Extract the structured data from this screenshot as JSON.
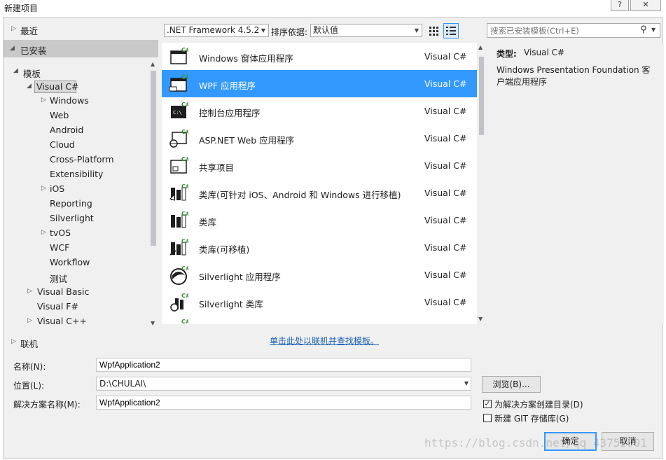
{
  "window": {
    "title": "新建项目",
    "help_glyph": "?",
    "close_glyph": "✕"
  },
  "tree": {
    "recent": "最近",
    "installed": "已安装",
    "templates": "模板",
    "visual_csharp": "Visual C#",
    "csharp_children": [
      "Windows",
      "Web",
      "Android",
      "Cloud",
      "Cross-Platform",
      "Extensibility",
      "iOS",
      "Reporting",
      "Silverlight",
      "tvOS",
      "WCF",
      "Workflow",
      "测试"
    ],
    "visual_basic": "Visual Basic",
    "visual_fsharp": "Visual F#",
    "visual_cpp": "Visual C++",
    "online": "联机"
  },
  "toolbar": {
    "framework": ".NET Framework 4.5.2",
    "sort_label": "排序依据:",
    "sort_value": "默认值",
    "search_placeholder": "搜索已安装模板(Ctrl+E)"
  },
  "templates": [
    {
      "name": "Windows 窗体应用程序",
      "lang": "Visual C#",
      "icon": "windows-form-icon"
    },
    {
      "name": "WPF 应用程序",
      "lang": "Visual C#",
      "icon": "wpf-app-icon"
    },
    {
      "name": "控制台应用程序",
      "lang": "Visual C#",
      "icon": "console-app-icon"
    },
    {
      "name": "ASP.NET Web 应用程序",
      "lang": "Visual C#",
      "icon": "asp-net-icon"
    },
    {
      "name": "共享项目",
      "lang": "Visual C#",
      "icon": "shared-project-icon"
    },
    {
      "name": "类库(可针对 iOS、Android 和 Windows 进行移植)",
      "lang": "Visual C#",
      "icon": "portable-library-icon"
    },
    {
      "name": "类库",
      "lang": "Visual C#",
      "icon": "class-library-icon"
    },
    {
      "name": "类库(可移植)",
      "lang": "Visual C#",
      "icon": "portable-class-library-icon"
    },
    {
      "name": "Silverlight 应用程序",
      "lang": "Visual C#",
      "icon": "silverlight-app-icon"
    },
    {
      "name": "Silverlight 类库",
      "lang": "Visual C#",
      "icon": "silverlight-library-icon"
    }
  ],
  "selected_index": 1,
  "online_link": "单击此处以联机并查找模板。",
  "details": {
    "type_label": "类型:",
    "type_value": "Visual C#",
    "description": "Windows Presentation Foundation 客户端应用程序"
  },
  "form": {
    "name_label": "名称(N):",
    "name_value": "WpfApplication2",
    "location_label": "位置(L):",
    "location_value": "D:\\CHULAI\\",
    "browse_label": "浏览(B)...",
    "solution_label": "解决方案名称(M):",
    "solution_value": "WpfApplication2",
    "create_dir_label": "为解决方案创建目录(D)",
    "create_dir_checked": true,
    "git_label": "新建 GIT 存储库(G)",
    "git_checked": false,
    "ok_label": "确定",
    "cancel_label": "取消"
  },
  "watermark": "https://blog.csdn.net/qq_43752001",
  "colors": {
    "selection": "#3399ff",
    "csharp_green": "#388a34",
    "link": "#1a5fb4"
  }
}
